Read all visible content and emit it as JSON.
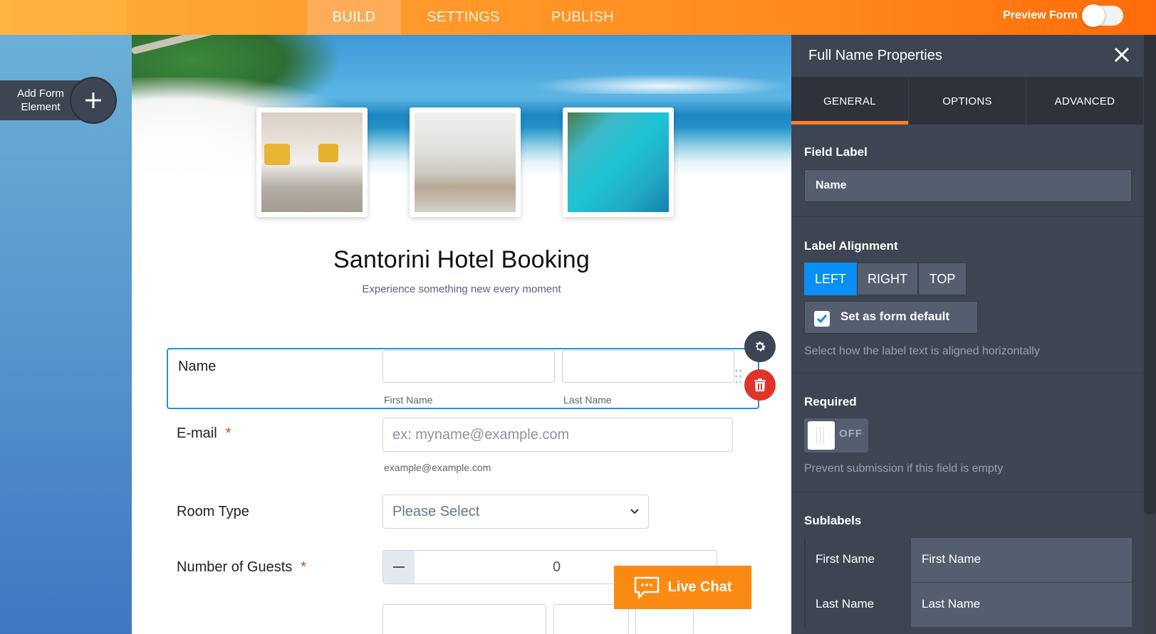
{
  "topbar": {
    "tabs": [
      {
        "label": "BUILD",
        "active": true
      },
      {
        "label": "SETTINGS",
        "active": false
      },
      {
        "label": "PUBLISH",
        "active": false
      }
    ],
    "preview_label": "Preview Form",
    "preview_enabled": false
  },
  "sidebar": {
    "add_element_label": "Add Form Element",
    "add_icon": "plus-icon"
  },
  "form": {
    "header_images": [
      "hotel-room-with-breakfast-tray",
      "modern-bedroom",
      "aerial-resort-lagoon"
    ],
    "title": "Santorini Hotel Booking",
    "subtitle": "Experience something new every moment",
    "fields": {
      "name": {
        "label": "Name",
        "first_value": "",
        "last_value": "",
        "first_sublabel": "First Name",
        "last_sublabel": "Last Name"
      },
      "email": {
        "label": "E-mail",
        "required_mark": "*",
        "placeholder": "ex: myname@example.com",
        "sublabel": "example@example.com"
      },
      "room_type": {
        "label": "Room Type",
        "selected": "Please Select"
      },
      "guests": {
        "label": "Number of Guests",
        "required_mark": "*",
        "minus": "−",
        "value": "0"
      }
    },
    "live_chat_label": "Live Chat"
  },
  "panel": {
    "title": "Full Name Properties",
    "tabs": [
      {
        "label": "GENERAL",
        "active": true
      },
      {
        "label": "OPTIONS",
        "active": false
      },
      {
        "label": "ADVANCED",
        "active": false
      }
    ],
    "field_label": {
      "title": "Field Label",
      "value": "Name"
    },
    "label_alignment": {
      "title": "Label Alignment",
      "options": [
        "LEFT",
        "RIGHT",
        "TOP"
      ],
      "selected": "LEFT",
      "set_default_label": "Set as form default",
      "set_default_checked": true,
      "hint": "Select how the label text is aligned horizontally"
    },
    "required": {
      "title": "Required",
      "state": "OFF",
      "hint": "Prevent submission if this field is empty"
    },
    "sublabels": {
      "title": "Sublabels",
      "rows": [
        {
          "key": "First Name",
          "value": "First Name"
        },
        {
          "key": "Last Name",
          "value": "Last Name"
        }
      ]
    }
  },
  "colors": {
    "accent_orange": "#ff8a1c",
    "selection_blue": "#2a8fd8",
    "active_alignment": "#0a8ff5",
    "panel_bg": "#3e4552",
    "delete_red": "#e0342a"
  }
}
